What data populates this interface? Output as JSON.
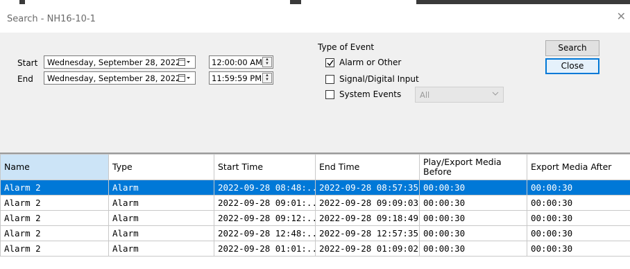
{
  "window": {
    "title": "Search - NH16-10-1"
  },
  "filters": {
    "start_label": "Start",
    "end_label": "End",
    "start_date": "Wednesday, September 28, 2022",
    "end_date": "Wednesday, September 28, 2022",
    "start_time": "12:00:00 AM",
    "end_time": "11:59:59 PM"
  },
  "event_type": {
    "heading": "Type of Event",
    "options": [
      {
        "label": "Alarm or Other",
        "checked": true
      },
      {
        "label": "Signal/Digital Input",
        "checked": false
      },
      {
        "label": "System Events",
        "checked": false
      }
    ],
    "system_events_value": "All"
  },
  "buttons": {
    "search": "Search",
    "close": "Close"
  },
  "table": {
    "columns": [
      "Name",
      "Type",
      "Start Time",
      "End Time",
      "Play/Export Media Before",
      "Export Media After"
    ],
    "rows": [
      [
        "Alarm 2",
        "Alarm",
        "2022-09-28 08:48:...",
        "2022-09-28 08:57:35...",
        "00:00:30",
        "00:00:30"
      ],
      [
        "Alarm 2",
        "Alarm",
        "2022-09-28 09:01:...",
        "2022-09-28 09:09:03...",
        "00:00:30",
        "00:00:30"
      ],
      [
        "Alarm 2",
        "Alarm",
        "2022-09-28 09:12:...",
        "2022-09-28 09:18:49...",
        "00:00:30",
        "00:00:30"
      ],
      [
        "Alarm 2",
        "Alarm",
        "2022-09-28 12:48:...",
        "2022-09-28 12:57:35...",
        "00:00:30",
        "00:00:30"
      ],
      [
        "Alarm 2",
        "Alarm",
        "2022-09-28 01:01:...",
        "2022-09-28 01:09:02...",
        "00:00:30",
        "00:00:30"
      ]
    ],
    "selected_row": 0
  },
  "colors": {
    "selection": "#0078d7",
    "header_selected": "#cce4f7",
    "panel": "#f0f0f0"
  }
}
